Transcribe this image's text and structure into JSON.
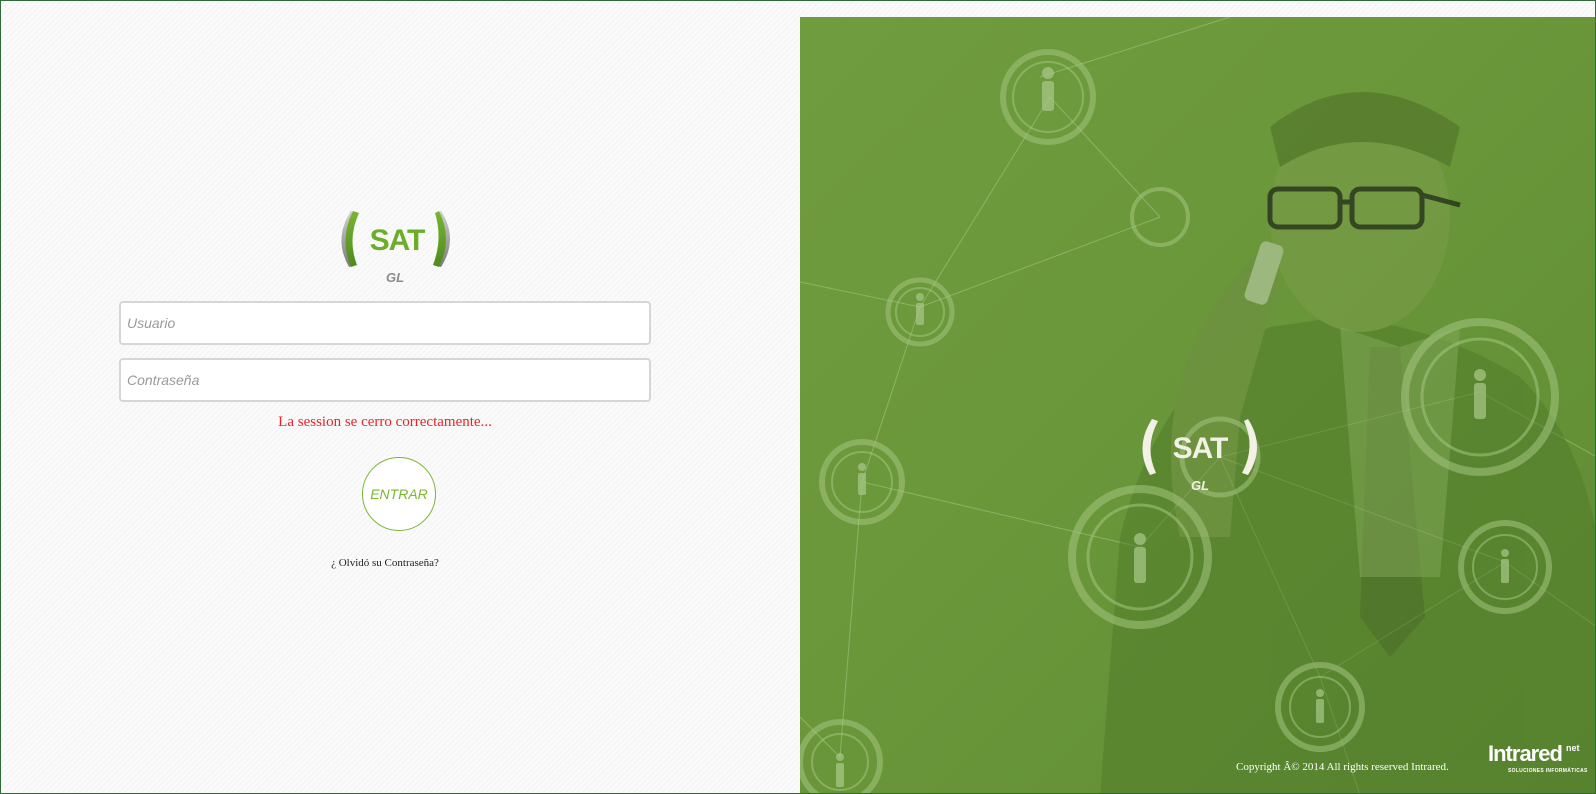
{
  "app": {
    "logo_text": "SAT",
    "logo_subtext": "GL"
  },
  "login": {
    "username_placeholder": "Usuario",
    "password_placeholder": "Contraseña",
    "username_value": "",
    "password_value": "",
    "message": "La session se cerro correctamente...",
    "submit_label": "ENTRAR",
    "forgot_label": "¿ Olvidó su Contraseña?"
  },
  "hero": {
    "logo_text": "SAT",
    "logo_subtext": "GL",
    "copyright": "Copyright Â© 2014  All rights reserved Intrared.",
    "brand_name": "Intrared",
    "brand_suffix": "net",
    "brand_tagline": "SOLUCIONES INFORMÁTICAS"
  },
  "colors": {
    "accent": "#7ab631",
    "error": "#e8232b",
    "hero_green": "#6a973a",
    "frame_border": "#2f6b3a"
  },
  "icons": {
    "network_person_icon": "person-node-icon"
  }
}
